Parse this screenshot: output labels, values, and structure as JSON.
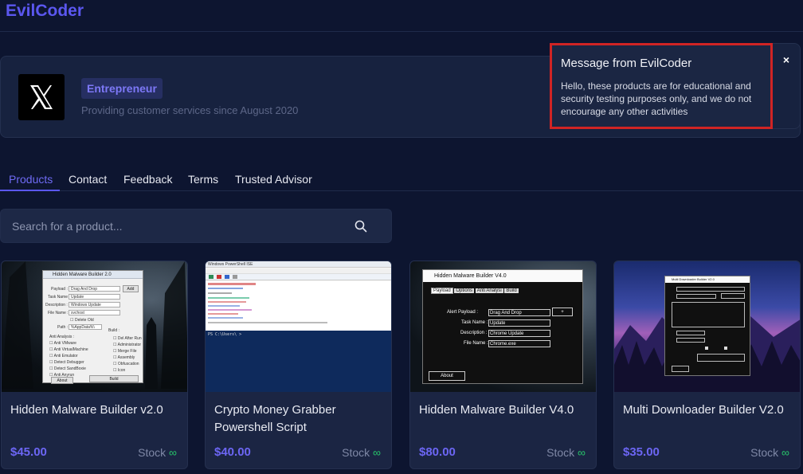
{
  "header": {
    "brand": "EvilCoder"
  },
  "profile": {
    "badge": "Entrepreneur",
    "tagline": "Providing customer services since August 2020"
  },
  "popup": {
    "title": "Message from EvilCoder",
    "body": "Hello, these products are for educational and security testing purposes only, and we do not encourage any other activities",
    "close": "×"
  },
  "tabs": [
    {
      "label": "Products",
      "active": true
    },
    {
      "label": "Contact"
    },
    {
      "label": "Feedback"
    },
    {
      "label": "Terms"
    },
    {
      "label": "Trusted Advisor"
    }
  ],
  "search": {
    "placeholder": "Search for a product..."
  },
  "stock_label": "Stock",
  "stock_symbol": "∞",
  "products": [
    {
      "title": "Hidden Malware Builder v2.0",
      "price": "$45.00",
      "screenshot": {
        "window_title": "Hidden Malware Builder 2.0",
        "fields": [
          {
            "label": "Payload :",
            "value": "Drag And Drop"
          },
          {
            "label": "Task Name :",
            "value": "Update"
          },
          {
            "label": "Description :",
            "value": "Windows Update"
          },
          {
            "label": "File Name :",
            "value": "svchost"
          }
        ],
        "path_label": "Path :",
        "path_value": "%AppData%\\",
        "delete_old": "Delete Old",
        "anti_analysis_label": "Anti Analysis :",
        "anti_analysis": [
          "Anti VMware",
          "Anti VirtualMachine",
          "Anti Emulator",
          "Detect Debugger",
          "Detect SandBoxie",
          "Anti Anyrun"
        ],
        "build_label": "Build :",
        "build_options": [
          "Del After Run",
          "Administrator",
          "Merge File",
          "Assembly",
          "Obfuscation",
          "Icon"
        ],
        "button_browse": "Add",
        "button_build": "Build",
        "button_about": "About"
      }
    },
    {
      "title": "Crypto Money Grabber Powershell Script",
      "price": "$40.00",
      "screenshot": {
        "window_title": "Windows PowerShell ISE",
        "console_prompt": "PS C:\\Users\\ >"
      }
    },
    {
      "title": "Hidden Malware Builder V4.0",
      "price": "$80.00",
      "screenshot": {
        "window_title": "Hidden Malware Builder V4.0",
        "tabs": [
          "Payload",
          "Options",
          "Anti Analysi",
          "Build"
        ],
        "fields": [
          {
            "label": "Alert Payload :",
            "value": "Drag And Drop"
          },
          {
            "label": "Task Name :",
            "value": "Update"
          },
          {
            "label": "Description :",
            "value": "Chrome Update"
          },
          {
            "label": "File Name :",
            "value": "Chrome.exe"
          }
        ],
        "button_small": "+",
        "button_about": "About"
      }
    },
    {
      "title": "Multi Downloader Builder V2.0",
      "price": "$35.00",
      "screenshot": {
        "window_title": "Multi Downloader Builder V2.0"
      }
    }
  ]
}
